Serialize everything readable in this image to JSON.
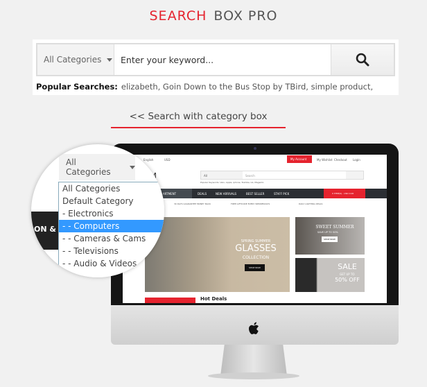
{
  "header": {
    "title_accent": "SEARCH",
    "title_rest": "BOX PRO"
  },
  "search": {
    "category": "All Categories",
    "placeholder": "Enter your keyword...",
    "popular_label": "Popular Searches:",
    "popular": "elizabeth, Goin Down to the Bus Stop by TBird,  simple product,"
  },
  "caption": "<< Search with category box",
  "colors": {
    "accent": "#e5232e",
    "selected": "#3399ff"
  },
  "dropdown": {
    "label": "All Categories",
    "options": [
      "All Categories",
      "Default Category",
      "- Electronics",
      "- - Computers",
      "- - Cameras & Cams",
      "- - Televisions",
      "- - Audio & Videos"
    ],
    "selected_index": 3,
    "side_text": "ON & A"
  },
  "screen": {
    "topbar": {
      "language": "English",
      "currency": "USD",
      "account": "My Account",
      "wishlist": "My Wishlist",
      "checkout": "Checkout",
      "login": "Login"
    },
    "logo": "TOM",
    "search_cat": "All",
    "search_placeholder": "Search",
    "keywords": "Popular Keywords: Vaio, Apple, iphone, Toshiba, LG, Magento",
    "nav": [
      "ARTMENT",
      "DEALS",
      "NEW ARRIVALS",
      "BEST SELLER",
      "STAFF PICK"
    ],
    "cart": "0 ITEM(S) - USD 0.00",
    "strip": [
      "30 DAYS GUARANTEE MONEY BACK",
      "FREE GIFTCODE EVERY WEDNESDAYS",
      "DAILY LIGHTING DEALS"
    ],
    "banner": {
      "line1": "SPRING SUMMER",
      "line2": "GLASSES",
      "line3": "COLLECTION",
      "cta": "SHOP NOW"
    },
    "side1": {
      "title": "SWEET SUMMER",
      "sub": "SAVE UP TO 50%",
      "cta": "SHOP NOW"
    },
    "side2": {
      "title": "SALE",
      "sub": "GET UP TO",
      "off": "50% OFF"
    },
    "hot": "Hot Deals"
  }
}
